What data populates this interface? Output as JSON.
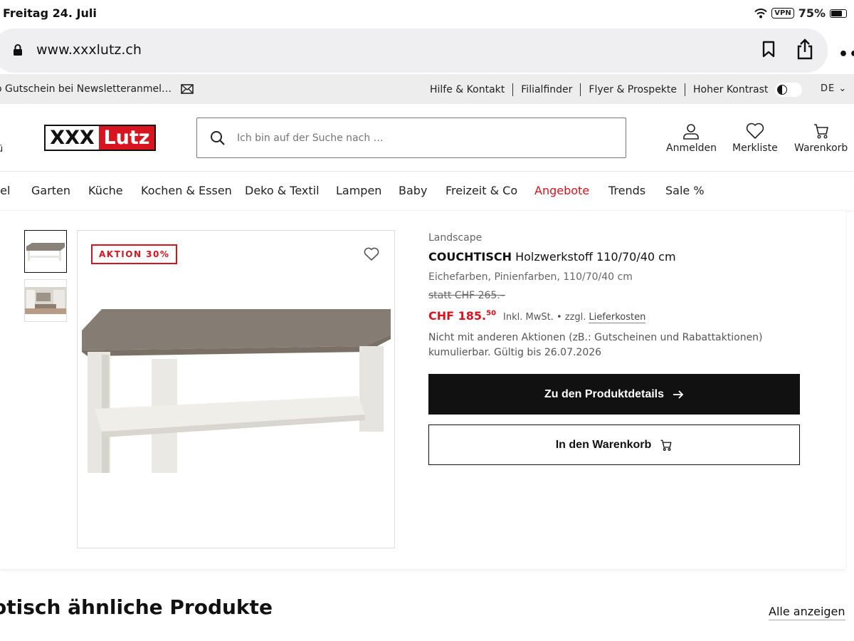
{
  "status": {
    "date": "Freitag 24. Juli",
    "vpn": "VPN",
    "battery": "75%",
    "battery_level": 0.75
  },
  "browser": {
    "url": "www.xxxlutz.ch",
    "icons": [
      "lock-icon",
      "bookmark-icon",
      "share-icon",
      "more-icon"
    ],
    "more_label": "•••"
  },
  "infobar": {
    "newsletter": "o Gutschein bei Newsletteranmel…",
    "links": [
      "Hilfe & Kontakt",
      "Filialfinder",
      "Flyer & Prospekte"
    ],
    "contrast_label": "Hoher Kontrast",
    "language": "DE ⌄"
  },
  "header": {
    "menu_fragment": "ü",
    "logo_left": "XXX",
    "logo_right": "Lutz",
    "search_placeholder": "Ich bin auf der Suche nach …",
    "actions": {
      "login": "Anmelden",
      "wishlist": "Merkliste",
      "cart": "Warenkorb"
    }
  },
  "categories": [
    {
      "label": "bel",
      "highlight": false
    },
    {
      "label": "Garten",
      "highlight": false
    },
    {
      "label": "Küche",
      "highlight": false
    },
    {
      "label": "Kochen & Essen",
      "highlight": false
    },
    {
      "label": "Deko & Textil",
      "highlight": false
    },
    {
      "label": "Lampen",
      "highlight": false
    },
    {
      "label": "Baby",
      "highlight": false
    },
    {
      "label": "Freizeit & Co",
      "highlight": false
    },
    {
      "label": "Angebote",
      "highlight": true
    },
    {
      "label": "Trends",
      "highlight": false
    },
    {
      "label": "Sale %",
      "highlight": false
    }
  ],
  "product": {
    "badge": "AKTION 30%",
    "brand": "Landscape",
    "title_bold": "COUCHTISCH",
    "title_rest": " Holzwerkstoff 110/70/40 cm",
    "variant": "Eichefarben, Pinienfarben, 110/70/40 cm",
    "old_price": "statt CHF 265.–",
    "price_main": "CHF 185.",
    "price_cents": "50",
    "tax_note": "Inkl. MwSt.  •  zzgl.",
    "shipping_link": "Lieferkosten",
    "notice": "Nicht mit anderen Aktionen (zB.: Gutscheinen und Rabattaktionen) kumulierbar. Gültig bis 26.07.2026",
    "details_button": "Zu den Produktdetails",
    "cart_button": "In den Warenkorb"
  },
  "similar": {
    "title": "otisch ähnliche Produkte",
    "show_all": "Alle anzeigen"
  },
  "colors": {
    "brand_red": "#d7141f",
    "primary_button": "#111111",
    "infobar_bg": "#ededed",
    "urlbar_bg": "#efeff2"
  }
}
